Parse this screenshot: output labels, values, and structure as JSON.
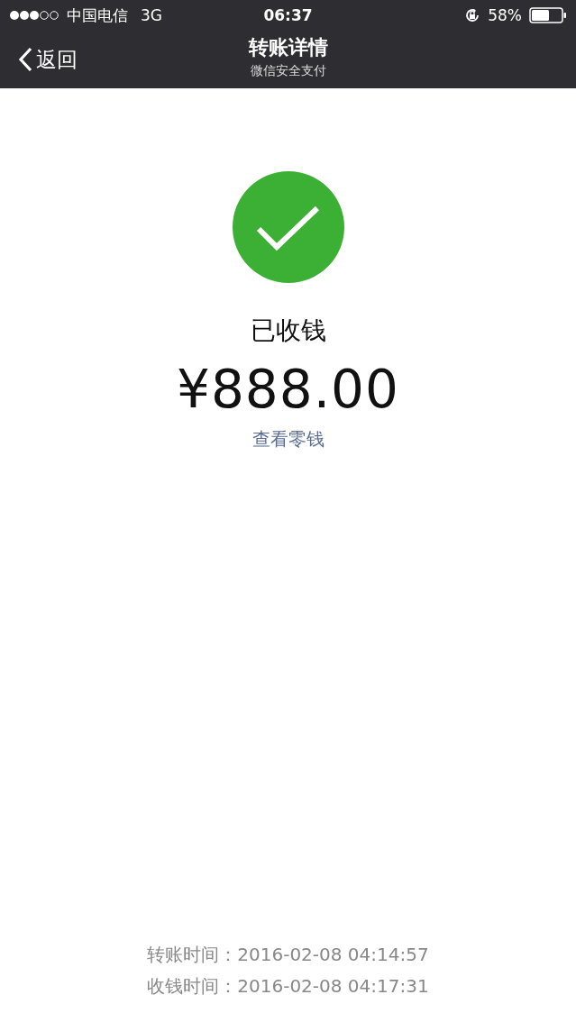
{
  "status_bar": {
    "carrier": "中国电信",
    "network": "3G",
    "time": "06:37",
    "battery": "58%"
  },
  "nav_bar": {
    "back": "返回",
    "title": "转账详情",
    "subtitle": "微信安全支付"
  },
  "result": {
    "status": "已收钱",
    "amount": "¥888.00",
    "link": "查看零钱"
  },
  "footer": [
    "转账时间：2016-02-08 04:14:57",
    "收钱时间：2016-02-08 04:17:31"
  ]
}
